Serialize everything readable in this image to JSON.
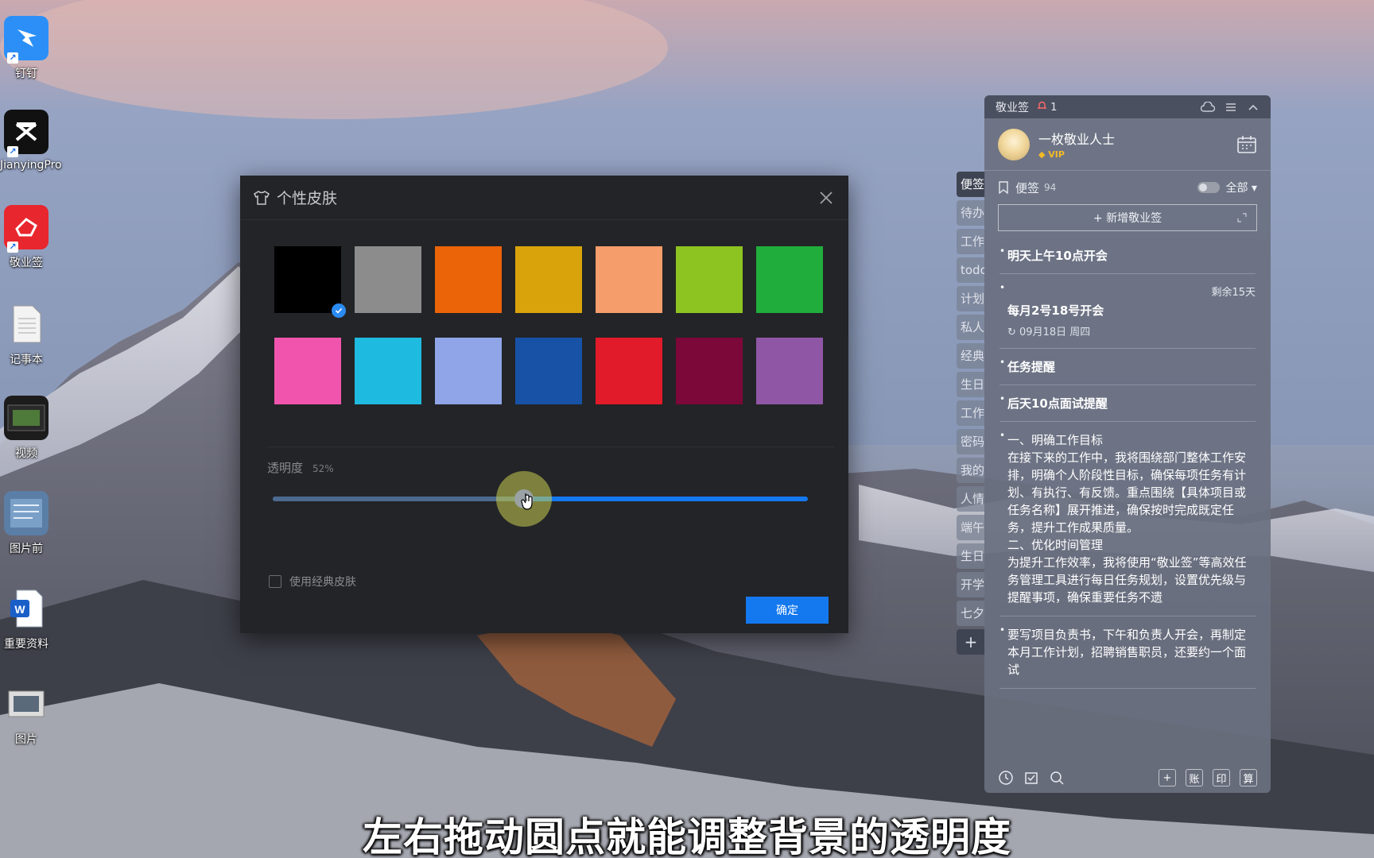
{
  "desktop": {
    "icons": [
      {
        "label": "钉钉",
        "icon": "dingtalk-icon"
      },
      {
        "label": "JianyingPro",
        "icon": "jianying-icon"
      },
      {
        "label": "敬业签",
        "icon": "jingyeqian-icon"
      },
      {
        "label": "记事本",
        "icon": "notepad-icon"
      },
      {
        "label": "视频",
        "icon": "video-icon"
      },
      {
        "label": "图片前",
        "icon": "image-folder-icon"
      },
      {
        "label": "重要资料",
        "icon": "word-icon"
      },
      {
        "label": "图片",
        "icon": "picture-icon"
      }
    ]
  },
  "dialog": {
    "title": "个性皮肤",
    "swatches": [
      "#000000",
      "#8c8c8c",
      "#ec6408",
      "#d9a40b",
      "#f69d6c",
      "#8ec422",
      "#21ad3b",
      "#f154ad",
      "#1fbadf",
      "#8fa5e8",
      "#1752a6",
      "#e21b2a",
      "#7c0739",
      "#8f56a6"
    ],
    "selected_swatch_index": 0,
    "opacity_label": "透明度",
    "opacity_value": "52%",
    "opacity_fraction": 0.47,
    "classic_skin_label": "使用经典皮肤",
    "classic_skin_checked": false,
    "ok_label": "确定"
  },
  "side_tabs": [
    "便签",
    "待办",
    "工作",
    "todo",
    "计划",
    "私人",
    "经典",
    "生日",
    "工作",
    "密码",
    "我的",
    "人情",
    "端午",
    "生日",
    "开学",
    "七夕",
    "+"
  ],
  "panel": {
    "app_name": "敬业签",
    "notification_count": "1",
    "user_name": "一枚敬业人士",
    "vip_label": "VIP",
    "section_title": "便签",
    "section_count": "94",
    "filter_label": "全部",
    "add_note_label": "+ 新增敬业签",
    "notes": [
      {
        "title": "明天上午10点开会",
        "sub": "",
        "remaining": "",
        "body": ""
      },
      {
        "title": "每月2号18号开会",
        "sub": "09月18日 周四",
        "remaining": "剩余15天",
        "body": ""
      },
      {
        "title": "任务提醒",
        "sub": "",
        "remaining": "",
        "body": ""
      },
      {
        "title": "后天10点面试提醒",
        "sub": "",
        "remaining": "",
        "body": ""
      },
      {
        "title": "一、明确工作目标",
        "sub": "",
        "remaining": "",
        "body": "在接下来的工作中，我将围绕部门整体工作安排，明确个人阶段性目标，确保每项任务有计划、有执行、有反馈。重点围绕【具体项目或任务名称】展开推进，确保按时完成既定任务，提升工作成果质量。\n二、优化时间管理\n为提升工作效率，我将使用“敬业签”等高效任务管理工具进行每日任务规划，设置优先级与提醒事项，确保重要任务不遗"
      },
      {
        "title": "",
        "sub": "",
        "remaining": "",
        "body": "要写项目负责书，下午和负责人开会，再制定本月工作计划，招聘销售职员，还要约一个面试"
      }
    ],
    "footer_buttons": [
      "账",
      "印",
      "算"
    ]
  },
  "caption": "左右拖动圆点就能调整背景的透明度"
}
